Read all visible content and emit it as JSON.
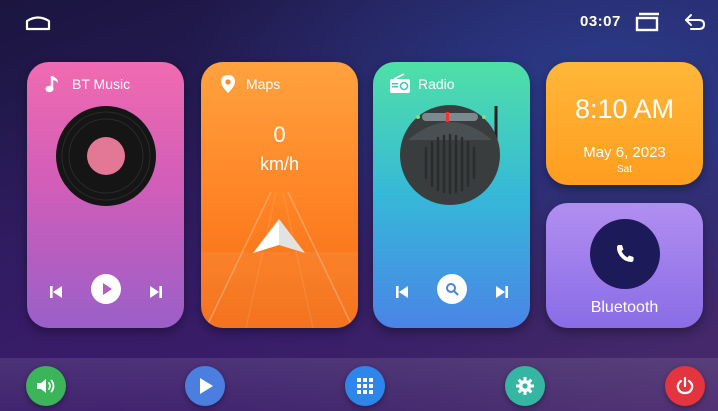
{
  "status_bar": {
    "time": "03:07"
  },
  "cards": {
    "music": {
      "title": "BT Music"
    },
    "maps": {
      "title": "Maps",
      "speed": "0",
      "unit": "km/h"
    },
    "radio": {
      "title": "Radio"
    },
    "clock": {
      "time": "8:10 AM",
      "date": "May 6, 2023",
      "day": "Sat"
    },
    "bluetooth": {
      "label": "Bluetooth"
    }
  },
  "dock": {
    "items": [
      {
        "icon": "volume-icon",
        "color": "#3bb45a"
      },
      {
        "icon": "play-icon",
        "color": "#4a7fe0"
      },
      {
        "icon": "apps-grid-icon",
        "color": "#2f86ea"
      },
      {
        "icon": "settings-gear-icon",
        "color": "#35b6a2"
      },
      {
        "icon": "power-icon",
        "color": "#e4353f"
      }
    ]
  },
  "colors": {
    "music": "#e466b4",
    "maps": "#ff8a2a",
    "radio": "#3fc8c0",
    "clock": "#ffab2c",
    "bluetooth": "#9d7deb"
  }
}
